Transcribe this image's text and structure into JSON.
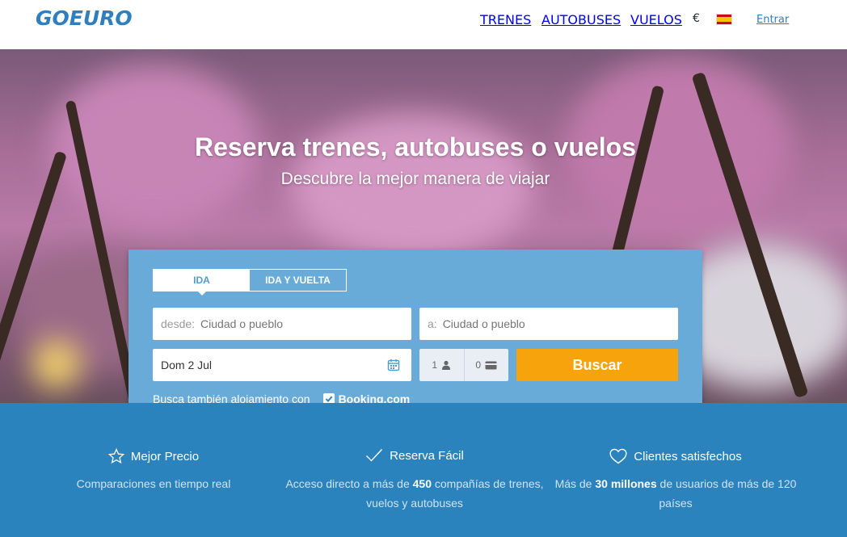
{
  "header": {
    "logo": "GOEURO",
    "nav": {
      "trains": "TRENES",
      "buses": "AUTOBUSES",
      "flights": "VUELOS",
      "currency": "€",
      "login": "Entrar"
    }
  },
  "hero": {
    "title": "Reserva trenes, autobuses o vuelos",
    "subtitle": "Descubre la mejor manera de viajar"
  },
  "search": {
    "tabs": {
      "one_way": "IDA",
      "round_trip": "IDA Y VUELTA"
    },
    "from_prefix": "desde:",
    "from_placeholder": "Ciudad o pueblo",
    "to_prefix": "a:",
    "to_placeholder": "Ciudad o pueblo",
    "date": "Dom 2 Jul",
    "adults": "1",
    "discount_cards": "0",
    "button": "Buscar",
    "booking_text": "Busca también alojamiento con",
    "booking_name": "Booking.com"
  },
  "features": [
    {
      "title": "Mejor Precio",
      "desc_a": "Comparaciones en tiempo real",
      "icon": "star-icon"
    },
    {
      "title": "Reserva Fácil",
      "desc_a": "Acceso directo a más de ",
      "desc_bold": "450",
      "desc_b": " compañías de trenes, vuelos y autobuses",
      "icon": "check-icon"
    },
    {
      "title": "Clientes satisfechos",
      "desc_a": "Más de ",
      "desc_bold": "30 millones",
      "desc_b": " de usuarios de más de 120 países",
      "icon": "heart-icon"
    }
  ],
  "colors": {
    "primary": "#2f7fbf",
    "search_bg": "#68abd8",
    "button": "#f7a30c",
    "features_bg": "#2b83bd"
  }
}
